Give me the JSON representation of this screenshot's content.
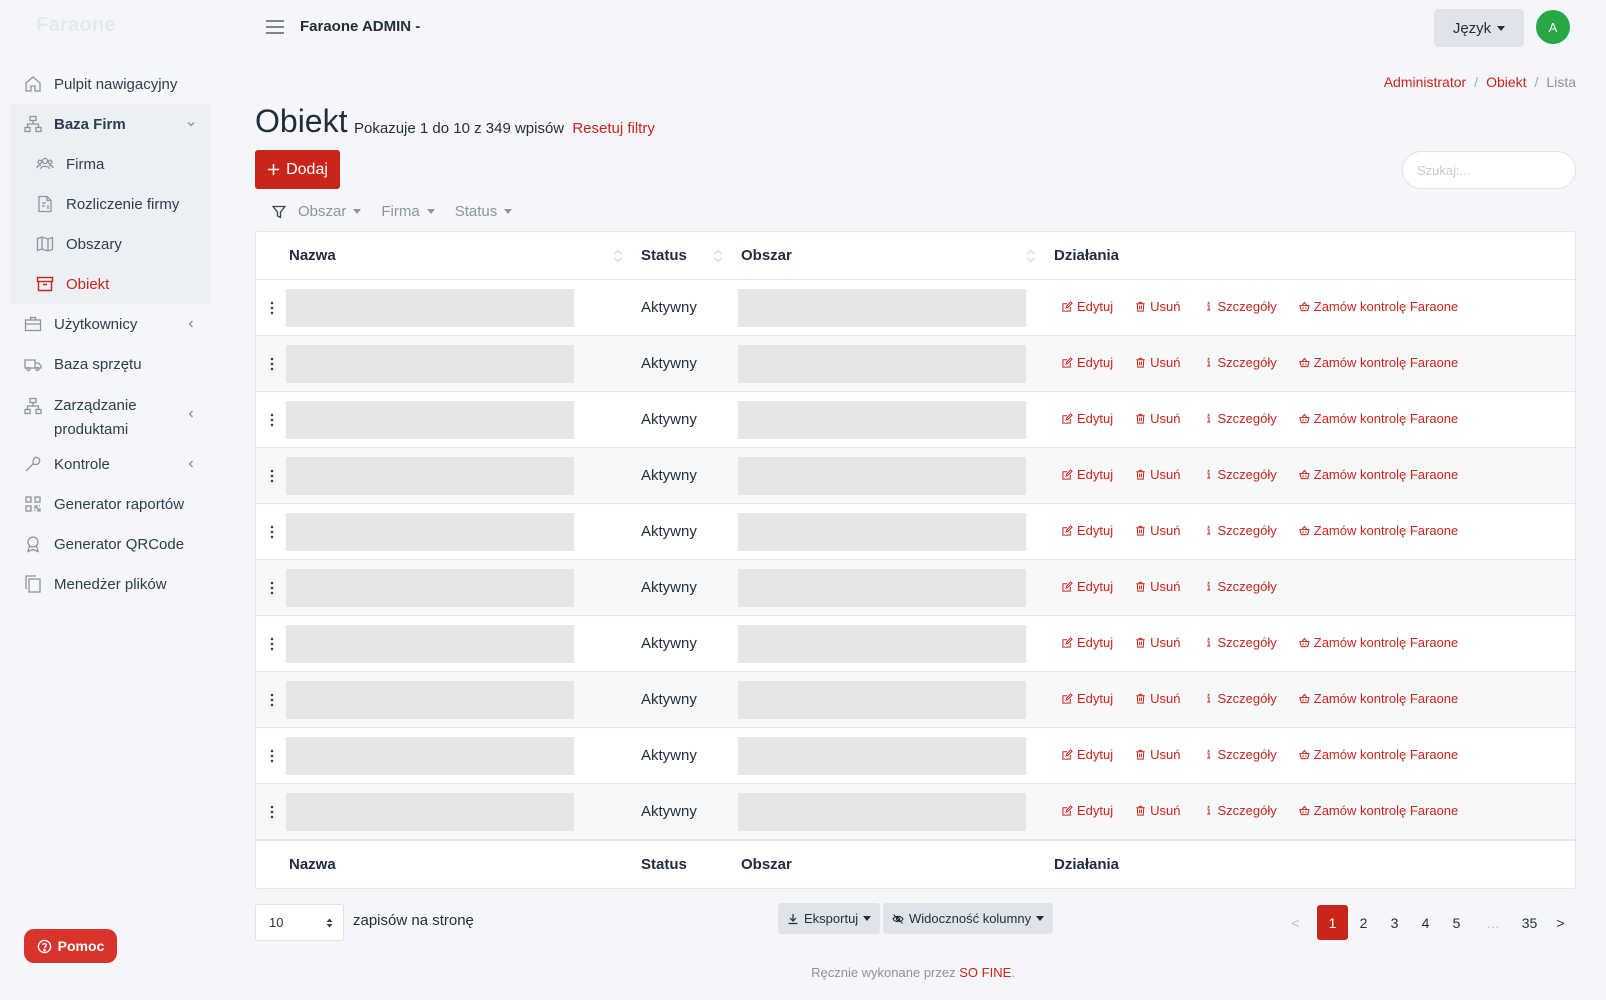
{
  "brand": "Faraone",
  "app_title": "Faraone ADMIN -",
  "language_button": "Język",
  "avatar_letter": "A",
  "sidebar": {
    "items": [
      {
        "label": "Pulpit nawigacyjny",
        "icon": "home-icon"
      },
      {
        "label": "Baza Firm",
        "icon": "sitemap-icon"
      },
      {
        "label": "Firma",
        "icon": "users-icon"
      },
      {
        "label": "Rozliczenie firmy",
        "icon": "invoice-icon"
      },
      {
        "label": "Obszary",
        "icon": "map-icon"
      },
      {
        "label": "Obiekt",
        "icon": "archive-icon"
      },
      {
        "label": "Użytkownicy",
        "icon": "briefcase-icon"
      },
      {
        "label": "Baza sprzętu",
        "icon": "truck-icon"
      },
      {
        "label": "Zarządzanie produktami",
        "icon": "sitemap-icon"
      },
      {
        "label": "Kontrole",
        "icon": "wrench-icon"
      },
      {
        "label": "Generator raportów",
        "icon": "qrcode-icon"
      },
      {
        "label": "Generator QRCode",
        "icon": "award-icon"
      },
      {
        "label": "Menedżer plików",
        "icon": "files-icon"
      }
    ],
    "help_button": "Pomoc"
  },
  "breadcrumb": {
    "items": [
      "Administrator",
      "Obiekt",
      "Lista"
    ]
  },
  "page": {
    "title": "Obiekt",
    "info": "Pokazuje 1 do 10 z 349 wpisów",
    "reset_filters": "Resetuj filtry",
    "add_button": "Dodaj",
    "search_placeholder": "Szukaj:..."
  },
  "filters": [
    "Obszar",
    "Firma",
    "Status"
  ],
  "table": {
    "columns": [
      "Nazwa",
      "Status",
      "Obszar",
      "Działania"
    ],
    "rows": [
      {
        "status": "Aktywny",
        "actions": [
          "Edytuj",
          "Usuń",
          "Szczegóły",
          "Zamów kontrolę Faraone"
        ]
      },
      {
        "status": "Aktywny",
        "actions": [
          "Edytuj",
          "Usuń",
          "Szczegóły",
          "Zamów kontrolę Faraone"
        ]
      },
      {
        "status": "Aktywny",
        "actions": [
          "Edytuj",
          "Usuń",
          "Szczegóły",
          "Zamów kontrolę Faraone"
        ]
      },
      {
        "status": "Aktywny",
        "actions": [
          "Edytuj",
          "Usuń",
          "Szczegóły",
          "Zamów kontrolę Faraone"
        ]
      },
      {
        "status": "Aktywny",
        "actions": [
          "Edytuj",
          "Usuń",
          "Szczegóły",
          "Zamów kontrolę Faraone"
        ]
      },
      {
        "status": "Aktywny",
        "actions": [
          "Edytuj",
          "Usuń",
          "Szczegóły"
        ]
      },
      {
        "status": "Aktywny",
        "actions": [
          "Edytuj",
          "Usuń",
          "Szczegóły",
          "Zamów kontrolę Faraone"
        ]
      },
      {
        "status": "Aktywny",
        "actions": [
          "Edytuj",
          "Usuń",
          "Szczegóły",
          "Zamów kontrolę Faraone"
        ]
      },
      {
        "status": "Aktywny",
        "actions": [
          "Edytuj",
          "Usuń",
          "Szczegóły",
          "Zamów kontrolę Faraone"
        ]
      },
      {
        "status": "Aktywny",
        "actions": [
          "Edytuj",
          "Usuń",
          "Szczegóły",
          "Zamów kontrolę Faraone"
        ]
      }
    ]
  },
  "bottom": {
    "per_page_value": "10",
    "per_page_label": "zapisów na stronę",
    "export_button": "Eksportuj",
    "columns_button": "Widoczność kolumny",
    "pagination": [
      "<",
      "1",
      "2",
      "3",
      "4",
      "5",
      "…",
      "35",
      ">"
    ],
    "current_page": "1"
  },
  "footer": {
    "text": "Ręcznie wykonane przez",
    "link": "SO FINE",
    "suffix": "."
  },
  "colors": {
    "accent": "#c8261b",
    "avatar": "#28a745",
    "help": "#d9342b"
  }
}
